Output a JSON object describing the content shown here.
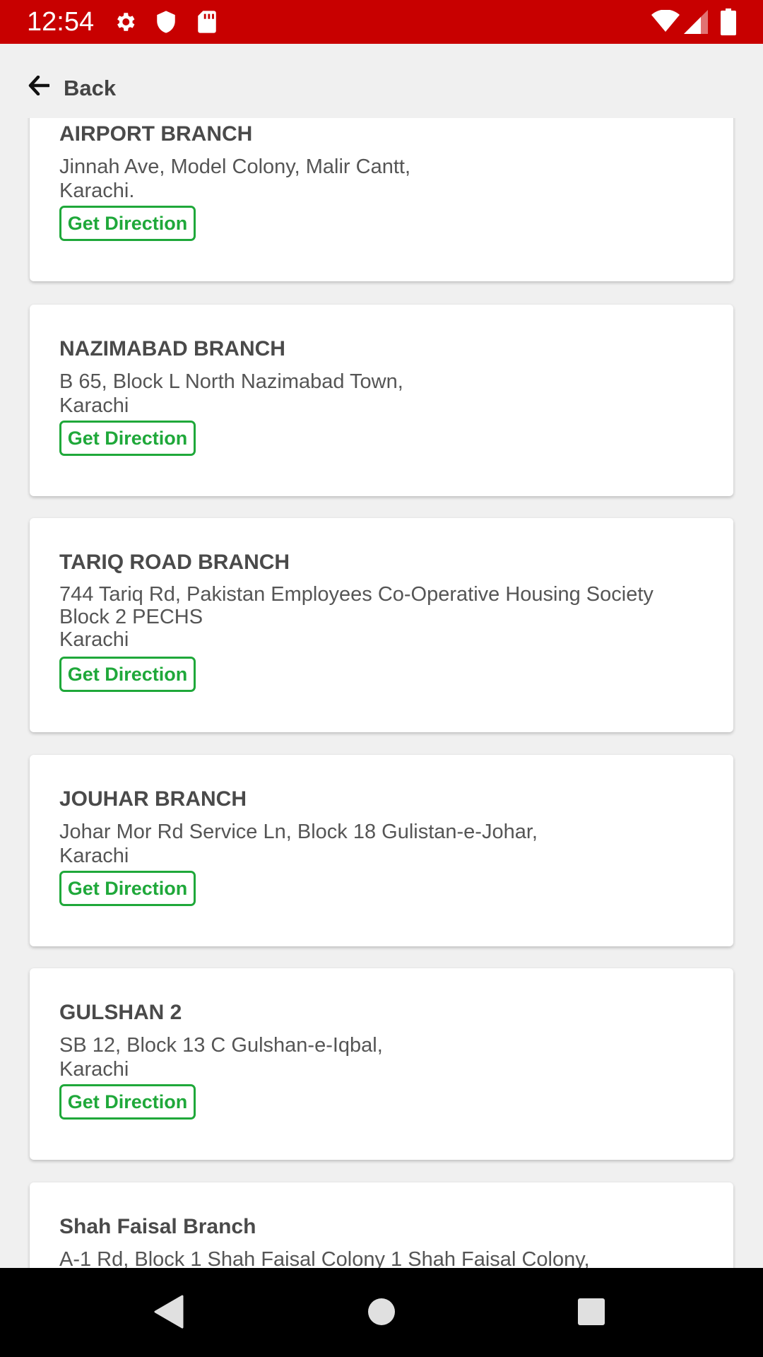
{
  "status_bar": {
    "time": "12:54",
    "left_icons": [
      "gear-icon",
      "shield-icon",
      "sd-card-icon"
    ],
    "right_icons": [
      "wifi-icon",
      "signal-icon",
      "battery-icon"
    ],
    "background": "#c80000"
  },
  "header": {
    "back_label": "Back"
  },
  "branches": [
    {
      "name": "AIRPORT BRANCH",
      "address_lines": [
        "Jinnah Ave, Model Colony, Malir Cantt,",
        "Karachi."
      ],
      "button": "Get Direction"
    },
    {
      "name": "NAZIMABAD BRANCH",
      "address_lines": [
        "B 65, Block L North Nazimabad Town,",
        "Karachi"
      ],
      "button": "Get Direction"
    },
    {
      "name": "TARIQ ROAD BRANCH",
      "address_lines": [
        "744 Tariq Rd, Pakistan Employees Co-Operative Housing Society",
        "Block 2 PECHS",
        "Karachi"
      ],
      "button": "Get Direction"
    },
    {
      "name": "JOUHAR BRANCH",
      "address_lines": [
        "Johar Mor Rd Service Ln, Block 18 Gulistan-e-Johar,",
        "Karachi"
      ],
      "button": "Get Direction"
    },
    {
      "name": "GULSHAN 2",
      "address_lines": [
        "SB 12, Block 13 C Gulshan-e-Iqbal,",
        "Karachi"
      ],
      "button": "Get Direction"
    },
    {
      "name": "Shah Faisal Branch",
      "address_lines": [
        "A-1 Rd, Block 1 Shah Faisal Colony 1 Shah Faisal Colony,"
      ],
      "button": ""
    }
  ],
  "colors": {
    "accent_green": "#1fa83a",
    "status_red": "#c80000"
  },
  "nav_bar": {
    "buttons": [
      "back-icon",
      "home-icon",
      "recents-icon"
    ]
  }
}
